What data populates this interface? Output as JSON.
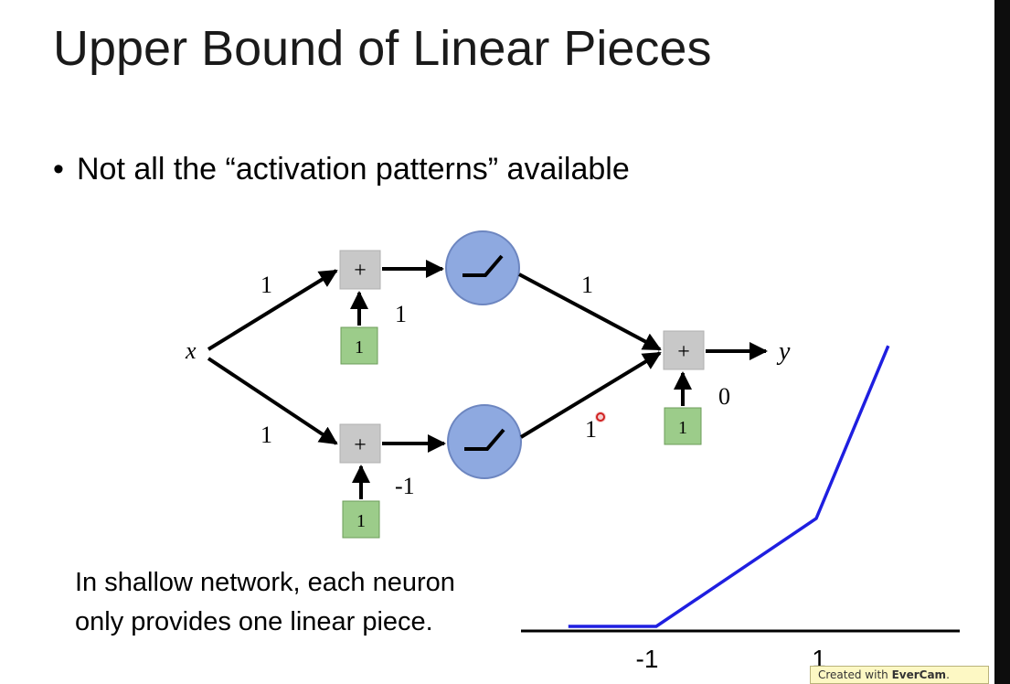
{
  "slide": {
    "title": "Upper Bound of Linear Pieces",
    "bullet": "Not all the “activation patterns” available",
    "caption": "In shallow network, each neuron only provides one linear piece."
  },
  "diagram": {
    "input_label": "x",
    "output_label": "y",
    "sum_symbol": "+",
    "weight_x_to_top": "1",
    "weight_x_to_bottom": "1",
    "bias_input_top": "1",
    "bias_weight_top": "1",
    "bias_input_bottom": "1",
    "bias_weight_bottom": "-1",
    "weight_top_to_out": "1",
    "weight_bottom_to_out": "1",
    "bias_input_out": "1",
    "bias_weight_out": "0",
    "colors": {
      "sum_box": "#c8c8c8",
      "bias_box": "#9ccc8a",
      "relu_circle": "#8ea9e0",
      "plot_line": "#1f1fe0"
    }
  },
  "plot": {
    "tick_labels": [
      "-1",
      "1"
    ],
    "points": [
      [
        -2.1,
        0
      ],
      [
        -1,
        0
      ],
      [
        1,
        2
      ],
      [
        1.9,
        5.2
      ]
    ]
  },
  "watermark": {
    "prefix": "Created with ",
    "brand": "EverCam",
    "suffix": "."
  }
}
